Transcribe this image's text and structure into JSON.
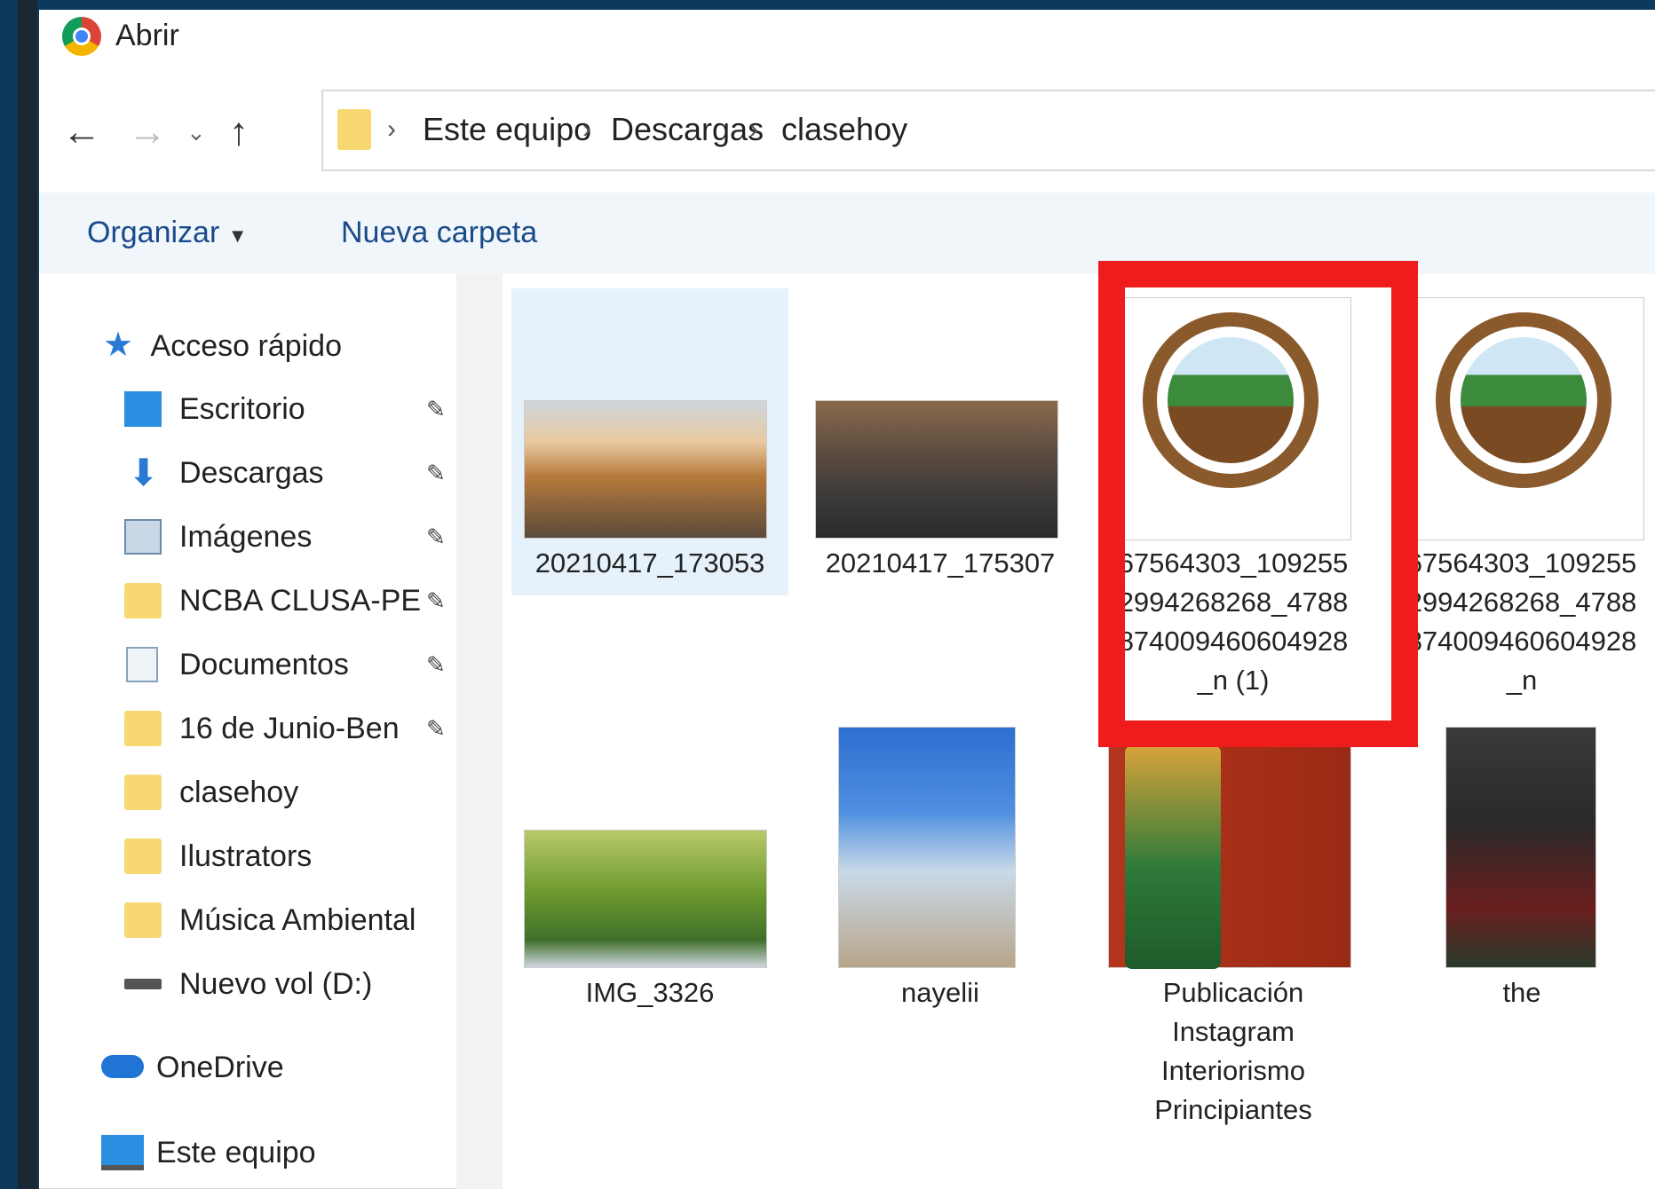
{
  "window": {
    "title": "Abrir"
  },
  "breadcrumb": [
    "Este equipo",
    "Descargas",
    "clasehoy"
  ],
  "toolbar": {
    "organize": "Organizar",
    "new_folder": "Nueva carpeta"
  },
  "sidebar": {
    "quick_access": "Acceso rápido",
    "items": [
      {
        "label": "Escritorio",
        "icon": "desktop-icon"
      },
      {
        "label": "Descargas",
        "icon": "download-icon"
      },
      {
        "label": "Imágenes",
        "icon": "pictures-icon"
      },
      {
        "label": "NCBA CLUSA-PE",
        "icon": "folder-icon"
      },
      {
        "label": "Documentos",
        "icon": "documents-icon"
      },
      {
        "label": "16 de Junio-Ben",
        "icon": "folder-icon"
      },
      {
        "label": "clasehoy",
        "icon": "folder-icon"
      },
      {
        "label": "Ilustrators",
        "icon": "folder-icon"
      },
      {
        "label": "Música Ambiental",
        "icon": "folder-icon"
      },
      {
        "label": "Nuevo vol (D:)",
        "icon": "drive-icon"
      }
    ],
    "onedrive": "OneDrive",
    "this_pc": "Este equipo"
  },
  "files": [
    {
      "caption": [
        "20210417_173053"
      ],
      "kind": "sunset-photo"
    },
    {
      "caption": [
        "20210417_175307"
      ],
      "kind": "dusk-photo"
    },
    {
      "caption": [
        "67564303_109255",
        "2994268268_4788",
        "874009460604928",
        "_n (1)"
      ],
      "kind": "seal-logo"
    },
    {
      "caption": [
        "67564303_109255",
        "2994268268_4788",
        "874009460604928",
        "_n"
      ],
      "kind": "seal-logo"
    },
    {
      "caption": [
        "IMG_3326"
      ],
      "kind": "field-photo"
    },
    {
      "caption": [
        "nayelii"
      ],
      "kind": "person-photo"
    },
    {
      "caption": [
        "Publicación",
        "Instagram",
        "Interiorismo",
        "Principiantes"
      ],
      "kind": "coffee-bag-red"
    },
    {
      "caption": [
        "the"
      ],
      "kind": "coffee-bag-dark"
    }
  ],
  "colors": {
    "highlight": "#ee1c1c",
    "selection": "#e5f1fb",
    "background": "#0d3a5c"
  }
}
